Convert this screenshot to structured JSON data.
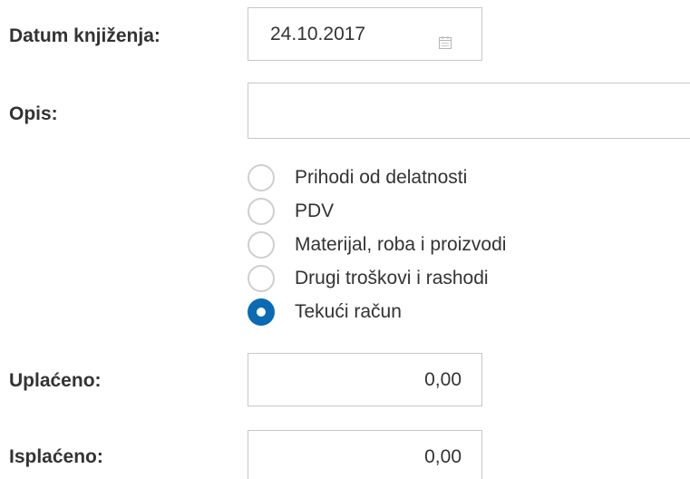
{
  "form": {
    "date_label": "Datum knjiženja:",
    "date_value": "24.10.2017",
    "description_label": "Opis:",
    "description_value": "",
    "account_options": [
      {
        "label": "Prihodi od delatnosti",
        "checked": false
      },
      {
        "label": "PDV",
        "checked": false
      },
      {
        "label": "Materijal, roba i proizvodi",
        "checked": false
      },
      {
        "label": "Drugi troškovi i rashodi",
        "checked": false
      },
      {
        "label": "Tekući račun",
        "checked": true
      }
    ],
    "paid_in_label": "Uplaćeno:",
    "paid_in_value": "0,00",
    "paid_out_label": "Isplaćeno:",
    "paid_out_value": "0,00"
  },
  "icons": {
    "date_picker": "calendar-icon"
  },
  "colors": {
    "accent": "#0a6ab3",
    "border": "#c8c8c8",
    "text": "#333333"
  }
}
